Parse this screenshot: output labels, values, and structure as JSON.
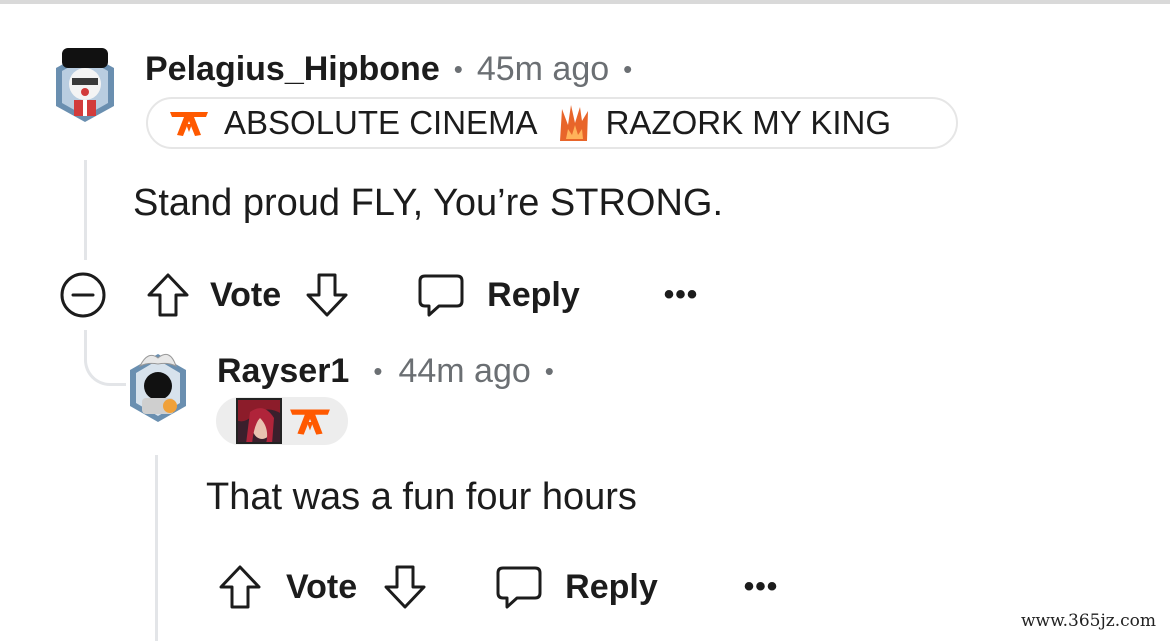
{
  "comment1": {
    "author": "Pelagius_Hipbone",
    "separator": "•",
    "time": "45m ago",
    "flair_1": "ABSOLUTE CINEMA",
    "flair_2": "RAZORK MY KING",
    "body": "Stand proud FLY, You’re STRONG.",
    "actions": {
      "vote": "Vote",
      "reply": "Reply",
      "more": "•••"
    }
  },
  "comment2": {
    "author": "Rayser1",
    "separator": "•",
    "time": "44m ago",
    "body": "That was a fun four hours",
    "actions": {
      "vote": "Vote",
      "reply": "Reply",
      "more": "•••"
    }
  },
  "watermark": "www.365jz.com",
  "colors": {
    "fnatic_orange": "#ff5900",
    "muted_text": "#6b6f73",
    "thread_line": "#e3e5e8"
  },
  "icons": [
    "avatar",
    "fnatic-logo-icon",
    "flame-crown-icon",
    "collapse-minus-icon",
    "upvote-arrow-icon",
    "downvote-arrow-icon",
    "reply-bubble-icon",
    "more-dots-icon",
    "champion-portrait-icon"
  ]
}
